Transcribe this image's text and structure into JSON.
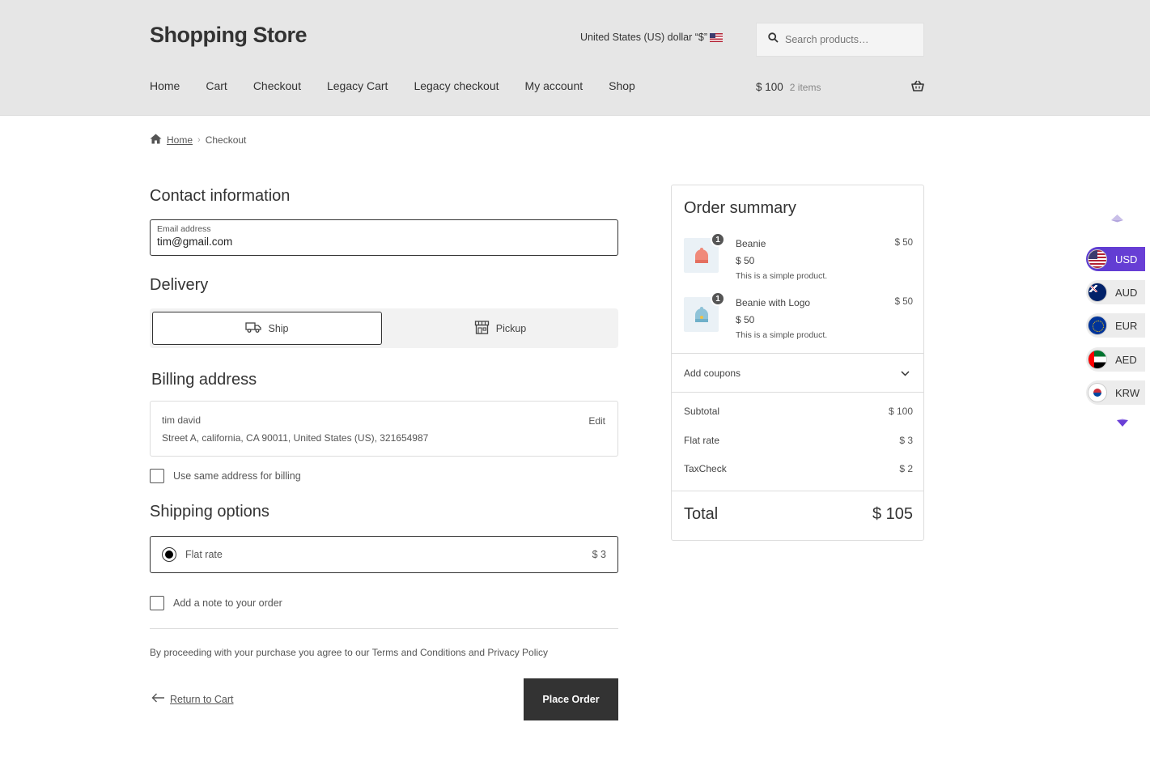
{
  "header": {
    "site_title": "Shopping Store",
    "currency_label": "United States (US) dollar “$”",
    "search_placeholder": "Search products…",
    "nav": [
      "Home",
      "Cart",
      "Checkout",
      "Legacy Cart",
      "Legacy checkout",
      "My account",
      "Shop"
    ],
    "cart_total": "$ 100",
    "cart_count": "2 items"
  },
  "breadcrumb": {
    "home": "Home",
    "current": "Checkout"
  },
  "contact": {
    "title": "Contact information",
    "email_label": "Email address",
    "email_value": "tim@gmail.com"
  },
  "delivery": {
    "title": "Delivery",
    "ship_label": "Ship",
    "pickup_label": "Pickup",
    "selected": "Ship"
  },
  "billing": {
    "title": "Billing address",
    "name": "tim david",
    "address": "Street A, california, CA 90011, United States (US), 321654987",
    "edit_label": "Edit",
    "same_address_label": "Use same address for billing",
    "same_address_checked": false
  },
  "shipping_options": {
    "title": "Shipping options",
    "option_label": "Flat rate",
    "option_price": "$ 3",
    "selected": true
  },
  "note": {
    "label": "Add a note to your order",
    "checked": false
  },
  "terms": "By proceeding with your purchase you agree to our Terms and Conditions and Privacy Policy",
  "actions": {
    "return_label": "Return to Cart",
    "place_order_label": "Place Order"
  },
  "summary": {
    "title": "Order summary",
    "items": [
      {
        "qty": "1",
        "name": "Beanie",
        "unit_price": "$ 50",
        "description": "This is a simple product.",
        "line_price": "$ 50",
        "color": "#f08a7a"
      },
      {
        "qty": "1",
        "name": "Beanie with Logo",
        "unit_price": "$ 50",
        "description": "This is a simple product.",
        "line_price": "$ 50",
        "color": "#8fc3d8"
      }
    ],
    "coupons_label": "Add coupons",
    "subtotal_label": "Subtotal",
    "subtotal_value": "$ 100",
    "shipping_label": "Flat rate",
    "shipping_value": "$ 3",
    "tax_label": "TaxCheck",
    "tax_value": "$ 2",
    "total_label": "Total",
    "total_value": "$ 105"
  },
  "currency_switcher": {
    "active": "USD",
    "options": [
      "USD",
      "AUD",
      "EUR",
      "AED",
      "KRW"
    ],
    "accent": "#5b3bd0"
  }
}
